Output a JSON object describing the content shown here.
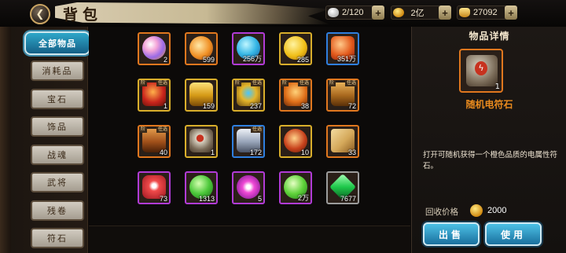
{
  "header": {
    "title": "背包",
    "back_icon": "back-arrow-icon",
    "resources": [
      {
        "name": "bag-capacity",
        "icon": "bag-icon",
        "value": "2/120"
      },
      {
        "name": "gold-coins",
        "icon": "coin-icon",
        "value": "2亿"
      },
      {
        "name": "gold-ingots",
        "icon": "ingot-icon",
        "value": "27092"
      }
    ],
    "plus_label": "+"
  },
  "categories": [
    {
      "label": "全部物品",
      "active": true
    },
    {
      "label": "消耗品",
      "active": false
    },
    {
      "label": "宝石",
      "active": false
    },
    {
      "label": "饰品",
      "active": false
    },
    {
      "label": "战魂",
      "active": false
    },
    {
      "label": "武将",
      "active": false
    },
    {
      "label": "残卷",
      "active": false
    },
    {
      "label": "符石",
      "active": false
    }
  ],
  "items": [
    {
      "icon": "rainbow-egg-icon",
      "qty": "2",
      "rarity": "orange",
      "tag": "",
      "tag2": ""
    },
    {
      "icon": "fire-orb-icon",
      "qty": "599",
      "rarity": "orange",
      "tag": "",
      "tag2": ""
    },
    {
      "icon": "blue-egg-icon",
      "qty": "256万",
      "rarity": "purple",
      "tag": "",
      "tag2": ""
    },
    {
      "icon": "gold-coin-icon",
      "qty": "285",
      "rarity": "gold",
      "tag": "",
      "tag2": ""
    },
    {
      "icon": "red-gem-icon",
      "qty": "351万",
      "rarity": "blue",
      "tag": "",
      "tag2": ""
    },
    {
      "icon": "red-mask-chest-icon",
      "qty": "1",
      "rarity": "gold",
      "tag": "阶",
      "tag2": "任选"
    },
    {
      "icon": "gold-chest-icon",
      "qty": "159",
      "rarity": "gold",
      "tag": "",
      "tag2": ""
    },
    {
      "icon": "jeweled-chest-icon",
      "qty": "237",
      "rarity": "gold",
      "tag": "阶",
      "tag2": "任选"
    },
    {
      "icon": "orange-crown-chest-icon",
      "qty": "38",
      "rarity": "orange",
      "tag": "阶",
      "tag2": "任选"
    },
    {
      "icon": "wooden-chest-icon",
      "qty": "72",
      "rarity": "orange",
      "tag": "阶",
      "tag2": "任选"
    },
    {
      "icon": "bronze-chest-icon",
      "qty": "40",
      "rarity": "orange",
      "tag": "阶",
      "tag2": "任选"
    },
    {
      "icon": "lightning-chest-icon",
      "qty": "1",
      "rarity": "gold",
      "tag": "",
      "tag2": ""
    },
    {
      "icon": "silver-chest-icon",
      "qty": "172",
      "rarity": "blue",
      "tag": "",
      "tag2": "任选"
    },
    {
      "icon": "red-pouch-icon",
      "qty": "10",
      "rarity": "gold",
      "tag": "",
      "tag2": ""
    },
    {
      "icon": "scroll-icon",
      "qty": "33",
      "rarity": "orange",
      "tag": "",
      "tag2": ""
    },
    {
      "icon": "red-flower-icon",
      "qty": "73",
      "rarity": "purple",
      "tag": "",
      "tag2": ""
    },
    {
      "icon": "green-orb-icon",
      "qty": "1313",
      "rarity": "purple",
      "tag": "",
      "tag2": ""
    },
    {
      "icon": "pink-orb-icon",
      "qty": "5",
      "rarity": "purple",
      "tag": "",
      "tag2": ""
    },
    {
      "icon": "green-paw-coin-icon",
      "qty": "2万",
      "rarity": "purple",
      "tag": "",
      "tag2": ""
    },
    {
      "icon": "green-crystal-icon",
      "qty": "7677",
      "rarity": "gray",
      "tag": "",
      "tag2": ""
    }
  ],
  "detail": {
    "section_title": "物品详情",
    "item_icon": "lightning-chest-icon",
    "item_qty": "1",
    "item_name": "随机电符石",
    "description": "打开可随机获得一个橙色品质的电属性符石。",
    "recycle_label": "回收价格",
    "recycle_icon": "coin-icon",
    "recycle_value": "2000",
    "sell_label": "出售",
    "use_label": "使用"
  },
  "colors": {
    "active_tab": "#1f86ad",
    "item_name": "#e88a1e",
    "rarity_orange": "#e0771e",
    "rarity_purple": "#b13bd6",
    "rarity_blue": "#2f7fde",
    "rarity_gold": "#d9ae2b",
    "rarity_gray": "#9c9c9c"
  }
}
